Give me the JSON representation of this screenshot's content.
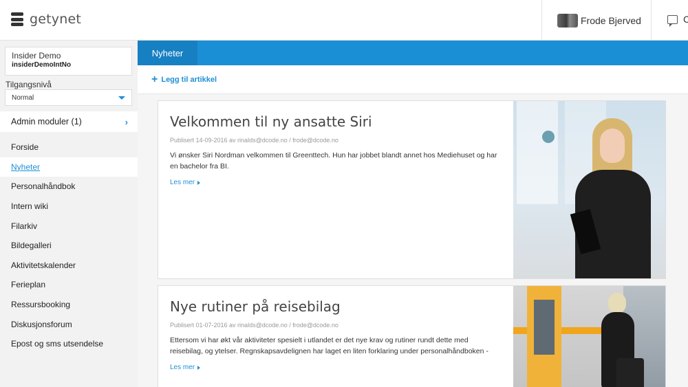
{
  "header": {
    "logo_text": "getynet",
    "user_name": "Frode Bjerved",
    "chat_label": "C"
  },
  "sidebar": {
    "account_name": "Insider Demo",
    "account_id": "insiderDemoIntNo",
    "access_label": "Tilgangsnivå",
    "access_value": "Normal",
    "admin_label": "Admin moduler (1)",
    "items": [
      {
        "label": "Forside"
      },
      {
        "label": "Nyheter"
      },
      {
        "label": "Personalhåndbok"
      },
      {
        "label": "Intern wiki"
      },
      {
        "label": "Filarkiv"
      },
      {
        "label": "Bildegalleri"
      },
      {
        "label": "Aktivitetskalender"
      },
      {
        "label": "Ferieplan"
      },
      {
        "label": "Ressursbooking"
      },
      {
        "label": "Diskusjonsforum"
      },
      {
        "label": "Epost og sms utsendelse"
      }
    ],
    "active_index": 1
  },
  "main": {
    "tab_label": "Nyheter",
    "add_article_label": "Legg til artikkel",
    "articles": [
      {
        "title": "Velkommen til ny ansatte Siri",
        "meta": "Publisert 14-09-2016 av rinalds@dcode.no / frode@dcode.no",
        "body": "Vi ønsker Siri Nordman velkommen til Greenttech. Hun har jobbet blandt annet hos Mediehuset og har en bachelor fra BI.",
        "read_more": "Les mer"
      },
      {
        "title": "Nye rutiner på reisebilag",
        "meta": "Publisert 01-07-2016 av rinalds@dcode.no / frode@dcode.no",
        "body": "Ettersom vi har økt vår aktiviteter spesielt i utlandet er det nye krav og rutiner rundt dette med reisebilag, og ytelser. Regnskapsavdelignen har laget en liten forklaring under personalhåndboken -",
        "read_more": "Les mer"
      }
    ]
  },
  "colors": {
    "accent": "#1a8fd6",
    "tab_active": "#1780c2",
    "sidebar_bg": "#f2f2f2"
  }
}
